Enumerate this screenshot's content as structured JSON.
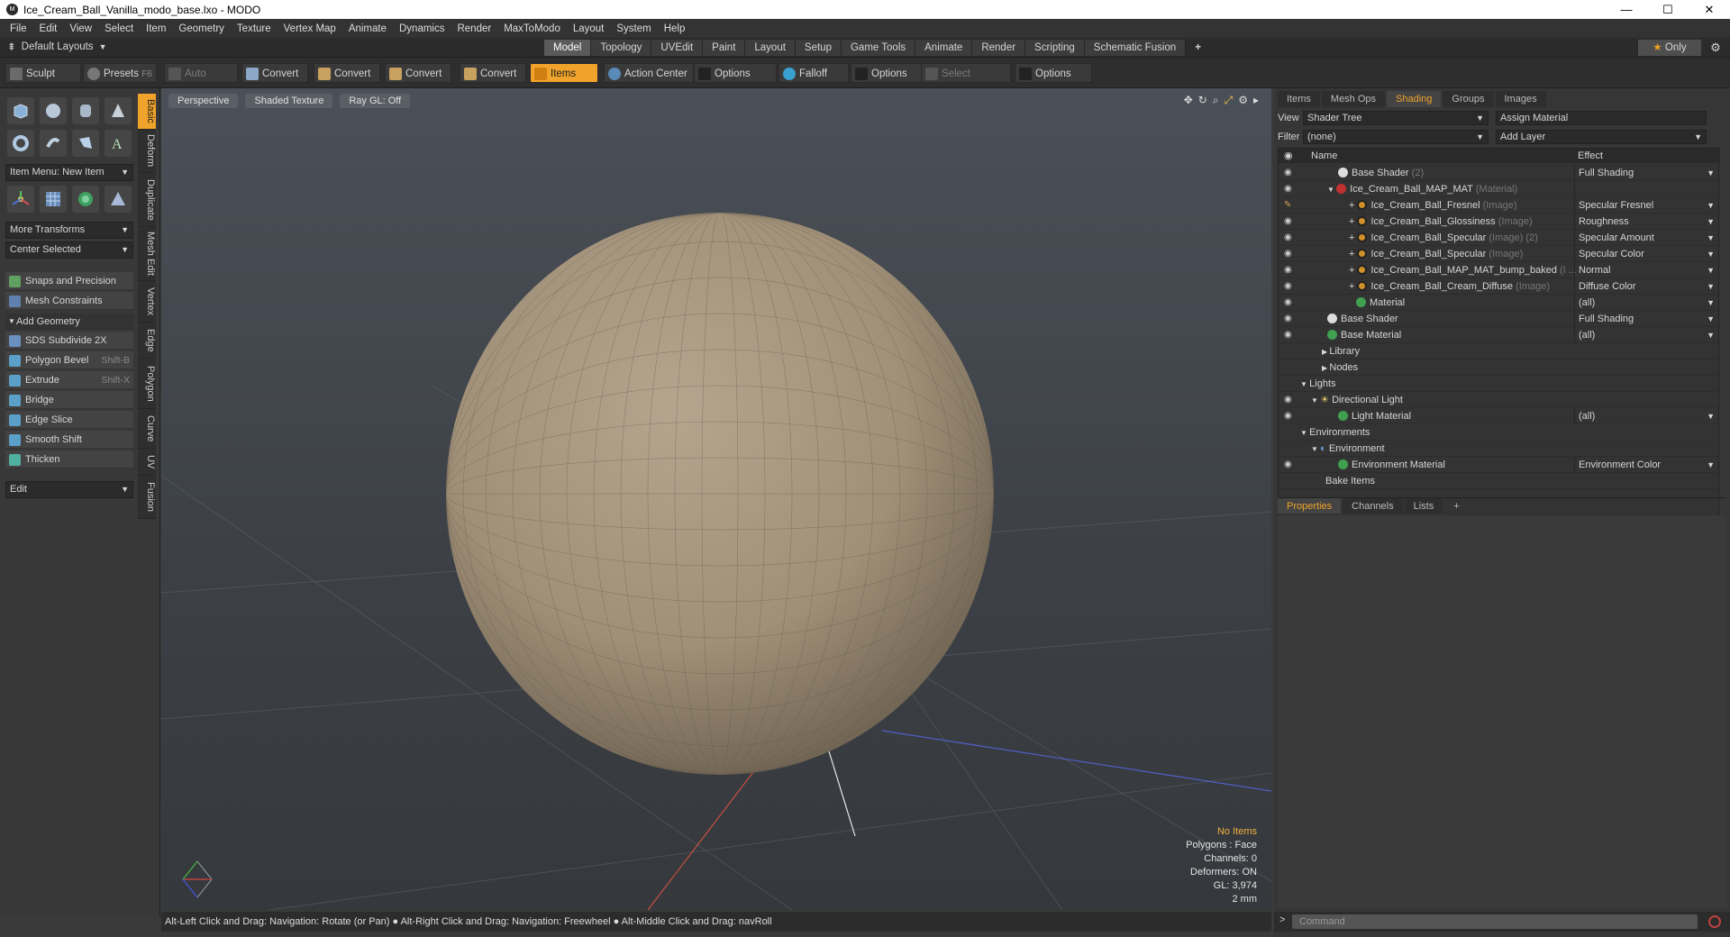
{
  "window": {
    "title": "Ice_Cream_Ball_Vanilla_modo_base.lxo - MODO",
    "minimize": "—",
    "maximize": "☐",
    "close": "✕"
  },
  "menu": [
    "File",
    "Edit",
    "View",
    "Select",
    "Item",
    "Geometry",
    "Texture",
    "Vertex Map",
    "Animate",
    "Dynamics",
    "Render",
    "MaxToModo",
    "Layout",
    "System",
    "Help"
  ],
  "layouts": {
    "selector": "Default Layouts",
    "tabs": [
      "Model",
      "Topology",
      "UVEdit",
      "Paint",
      "Layout",
      "Setup",
      "Game Tools",
      "Animate",
      "Render",
      "Scripting",
      "Schematic Fusion"
    ],
    "active": "Model",
    "add": "+",
    "only": "Only"
  },
  "toolbar": {
    "sculpt": "Sculpt",
    "presets": "Presets",
    "presets_key": "F6",
    "auto_select": "Auto Select",
    "convert": "Convert",
    "items": "Items",
    "action_center": "Action Center",
    "options": "Options",
    "falloff": "Falloff",
    "select_through": "Select Through"
  },
  "left": {
    "item_menu": "Item Menu: New Item",
    "more_transforms": "More Transforms",
    "center_selected": "Center Selected",
    "snaps": "Snaps and Precision",
    "mesh_constraints": "Mesh Constraints",
    "add_geometry": "Add Geometry",
    "tools": [
      {
        "label": "SDS Subdivide 2X",
        "key": ""
      },
      {
        "label": "Polygon Bevel",
        "key": "Shift-B"
      },
      {
        "label": "Extrude",
        "key": "Shift-X"
      },
      {
        "label": "Bridge",
        "key": ""
      },
      {
        "label": "Edge Slice",
        "key": ""
      },
      {
        "label": "Smooth Shift",
        "key": ""
      },
      {
        "label": "Thicken",
        "key": ""
      }
    ],
    "edit": "Edit",
    "side_tabs": [
      "Basic",
      "Deform",
      "Duplicate",
      "Mesh Edit",
      "Vertex",
      "Edge",
      "Polygon",
      "Curve",
      "UV",
      "Fusion"
    ]
  },
  "viewport": {
    "perspective": "Perspective",
    "shading": "Shaded Texture",
    "raygl": "Ray GL: Off",
    "info": {
      "no_items": "No Items",
      "polygons": "Polygons : Face",
      "channels": "Channels: 0",
      "deformers": "Deformers: ON",
      "gl": "GL: 3,974",
      "scale": "2 mm"
    }
  },
  "status": "Alt-Left Click and Drag: Navigation: Rotate (or Pan) ● Alt-Right Click and Drag: Navigation: Freewheel ● Alt-Middle Click and Drag: navRoll",
  "right": {
    "tabs": [
      "Items",
      "Mesh Ops",
      "Shading",
      "Groups",
      "Images"
    ],
    "active_tab": "Shading",
    "view_label": "View",
    "view_value": "Shader Tree",
    "assign": "Assign Material",
    "filter_label": "Filter",
    "filter_value": "(none)",
    "add_layer": "Add Layer",
    "col_name": "Name",
    "col_effect": "Effect",
    "rows": [
      {
        "name": "Base Shader",
        "sub": "(2)",
        "effect": "Full Shading"
      },
      {
        "name": "Ice_Cream_Ball_MAP_MAT",
        "sub": "(Material)",
        "effect": ""
      },
      {
        "name": "Ice_Cream_Ball_Fresnel",
        "sub": "(Image)",
        "effect": "Specular Fresnel"
      },
      {
        "name": "Ice_Cream_Ball_Glossiness",
        "sub": "(Image)",
        "effect": "Roughness"
      },
      {
        "name": "Ice_Cream_Ball_Specular",
        "sub": "(Image) (2)",
        "effect": "Specular Amount"
      },
      {
        "name": "Ice_Cream_Ball_Specular",
        "sub": "(Image)",
        "effect": "Specular Color"
      },
      {
        "name": "Ice_Cream_Ball_MAP_MAT_bump_baked",
        "sub": "(I ...",
        "effect": "Normal"
      },
      {
        "name": "Ice_Cream_Ball_Cream_Diffuse",
        "sub": "(Image)",
        "effect": "Diffuse Color"
      },
      {
        "name": "Material",
        "sub": "",
        "effect": "(all)"
      },
      {
        "name": "Base Shader",
        "sub": "",
        "effect": "Full Shading"
      },
      {
        "name": "Base Material",
        "sub": "",
        "effect": "(all)"
      },
      {
        "name": "Library",
        "sub": "",
        "effect": ""
      },
      {
        "name": "Nodes",
        "sub": "",
        "effect": ""
      },
      {
        "name": "Lights",
        "sub": "",
        "effect": ""
      },
      {
        "name": "Directional Light",
        "sub": "",
        "effect": ""
      },
      {
        "name": "Light Material",
        "sub": "",
        "effect": "(all)"
      },
      {
        "name": "Environments",
        "sub": "",
        "effect": ""
      },
      {
        "name": "Environment",
        "sub": "",
        "effect": ""
      },
      {
        "name": "Environment Material",
        "sub": "",
        "effect": "Environment Color"
      },
      {
        "name": "Bake Items",
        "sub": "",
        "effect": ""
      }
    ],
    "prop_tabs": [
      "Properties",
      "Channels",
      "Lists"
    ],
    "command_placeholder": "Command"
  }
}
